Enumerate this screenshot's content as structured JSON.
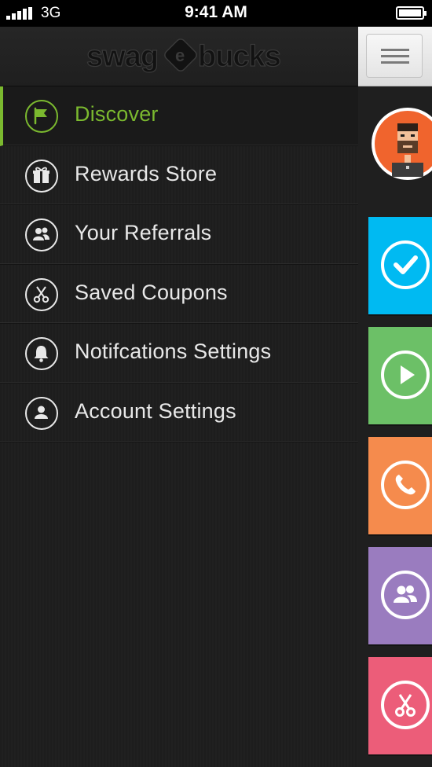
{
  "status_bar": {
    "carrier": "3G",
    "time": "9:41 AM"
  },
  "app": {
    "logo_text": "swagbucks"
  },
  "menu": {
    "items": [
      {
        "label": "Discover",
        "icon": "flag-icon",
        "active": true
      },
      {
        "label": "Rewards Store",
        "icon": "gift-icon",
        "active": false
      },
      {
        "label": "Your Referrals",
        "icon": "users-icon",
        "active": false
      },
      {
        "label": "Saved Coupons",
        "icon": "scissors-icon",
        "active": false
      },
      {
        "label": "Notifcations Settings",
        "icon": "bell-icon",
        "active": false
      },
      {
        "label": "Account Settings",
        "icon": "user-icon",
        "active": false
      }
    ]
  },
  "colors": {
    "accent": "#7bb92f",
    "tile_blue": "#00baf2",
    "tile_green": "#6cc067",
    "tile_orange": "#f58b4d",
    "tile_purple": "#9a7cbf",
    "tile_pink": "#ec5d79"
  },
  "tiles": [
    {
      "name": "check-icon",
      "color": "#00baf2"
    },
    {
      "name": "play-icon",
      "color": "#6cc067"
    },
    {
      "name": "phone-icon",
      "color": "#f58b4d"
    },
    {
      "name": "users-icon",
      "color": "#9a7cbf"
    },
    {
      "name": "scissors-icon",
      "color": "#ec5d79"
    }
  ]
}
